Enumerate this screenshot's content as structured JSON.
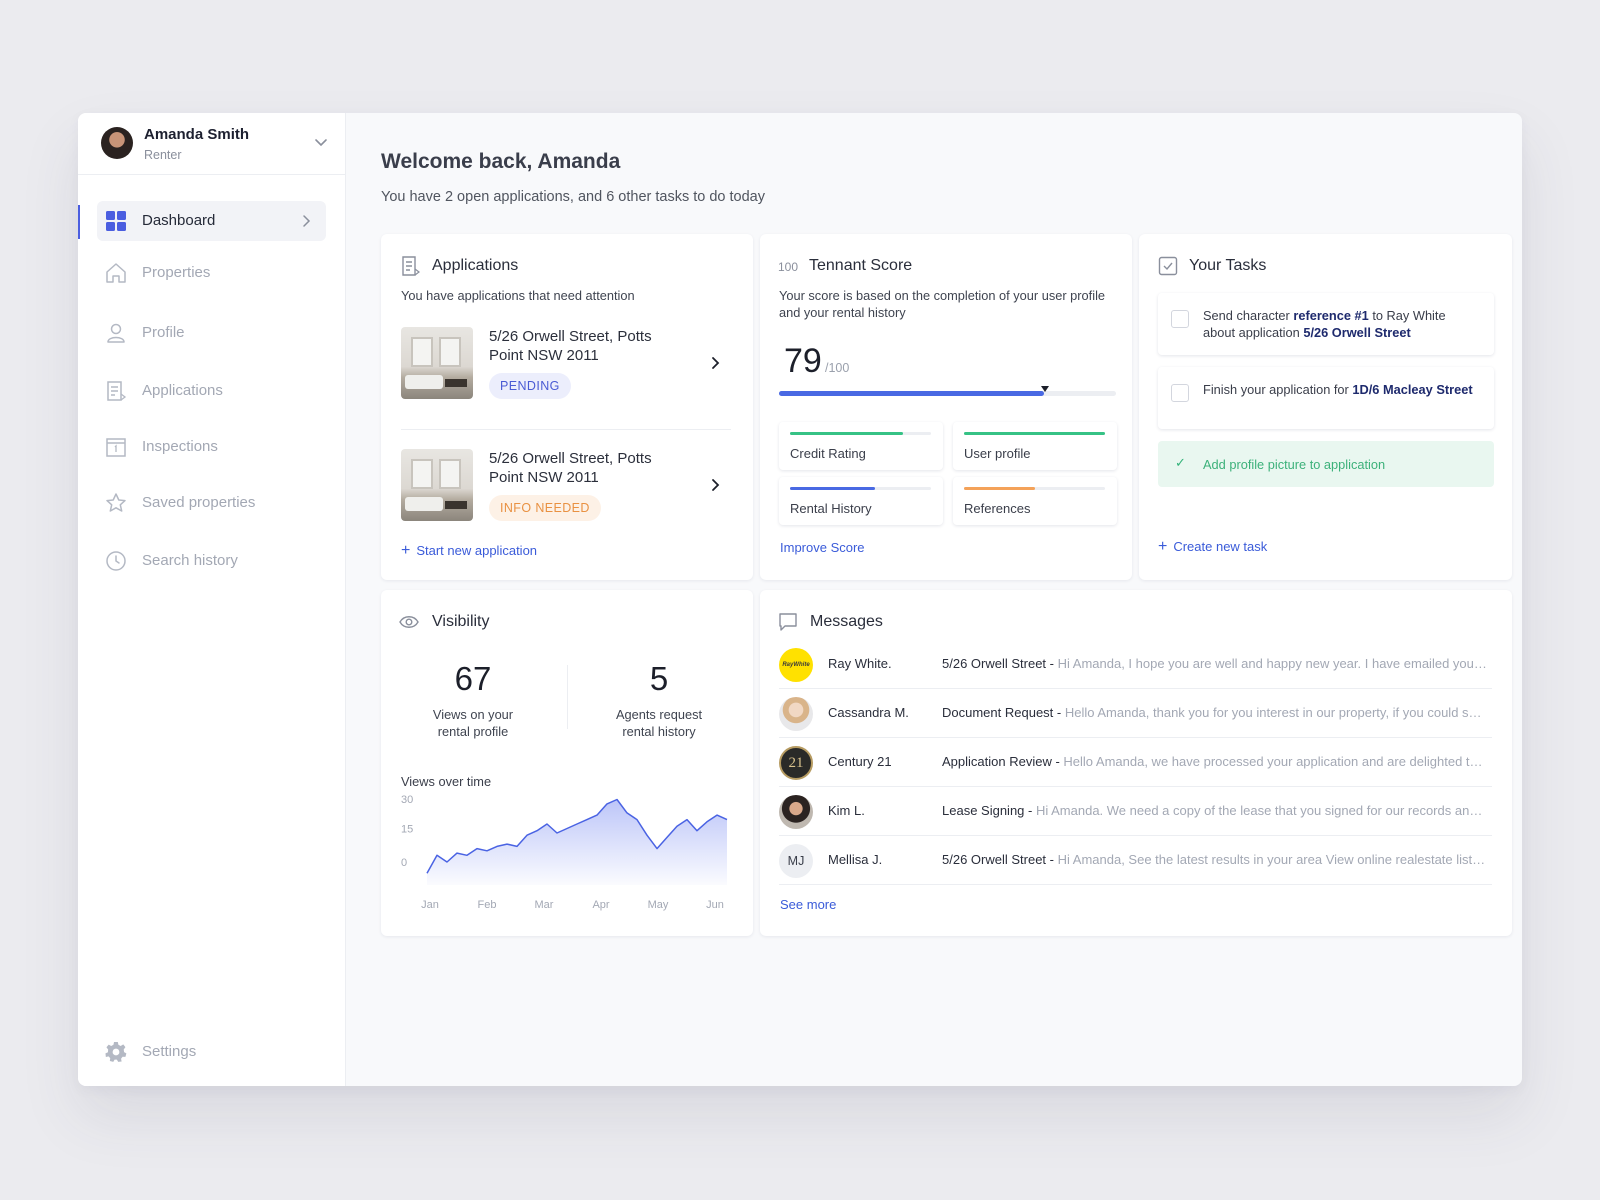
{
  "user": {
    "name": "Amanda Smith",
    "role": "Renter"
  },
  "nav": {
    "items": [
      {
        "label": "Dashboard",
        "icon": "grid-icon",
        "active": true
      },
      {
        "label": "Properties",
        "icon": "home-icon"
      },
      {
        "label": "Profile",
        "icon": "user-icon"
      },
      {
        "label": "Applications",
        "icon": "document-icon"
      },
      {
        "label": "Inspections",
        "icon": "calendar-icon"
      },
      {
        "label": "Saved properties",
        "icon": "star-icon"
      },
      {
        "label": "Search history",
        "icon": "clock-icon"
      }
    ],
    "settings_label": "Settings"
  },
  "header": {
    "welcome": "Welcome back, Amanda",
    "subtitle": "You have 2 open applications, and 6 other tasks to do today"
  },
  "applications": {
    "title": "Applications",
    "description": "You have applications that need attention",
    "items": [
      {
        "address": "5/26 Orwell Street, Potts Point NSW 2011",
        "status": "PENDING"
      },
      {
        "address": "5/26 Orwell Street, Potts Point NSW 2011",
        "status": "INFO NEEDED"
      }
    ],
    "new_link": "Start new application"
  },
  "score": {
    "icon_text": "100",
    "title": "Tennant Score",
    "description": "Your score is based on the completion of your user profile and your rental history",
    "value": "79",
    "max": "/100",
    "progress": 0.79,
    "factors": [
      {
        "label": "Credit Rating",
        "progress": 0.8,
        "color": "#36c285"
      },
      {
        "label": "User profile",
        "progress": 1.0,
        "color": "#36c285"
      },
      {
        "label": "Rental History",
        "progress": 0.6,
        "color": "#4969e3"
      },
      {
        "label": "References",
        "progress": 0.5,
        "color": "#f4a259"
      }
    ],
    "improve_link": "Improve Score"
  },
  "tasks": {
    "title": "Your Tasks",
    "items": [
      {
        "parts": [
          "Send character ",
          "reference #1",
          " to Ray White about application ",
          "5/26 Orwell Street"
        ]
      },
      {
        "parts": [
          "Finish your application for ",
          "1D/6 Macleay Street"
        ]
      }
    ],
    "done_item": "Add profile picture to application",
    "new_link": "Create new task"
  },
  "visibility": {
    "title": "Visibility",
    "views_value": "67",
    "views_label": "Views on your rental profile",
    "requests_value": "5",
    "requests_label": "Agents request rental history",
    "chart_title": "Views over time"
  },
  "chart_data": {
    "type": "area",
    "title": "Views over time",
    "categories": [
      "Jan",
      "Feb",
      "Mar",
      "Apr",
      "May",
      "Jun"
    ],
    "yticks": [
      0,
      15,
      30
    ],
    "ylim": [
      0,
      30
    ],
    "series": [
      {
        "values": [
          -5,
          3,
          0,
          4,
          3,
          6,
          5,
          7,
          8,
          7,
          12,
          14,
          17,
          13,
          15,
          17,
          19,
          21,
          26,
          28,
          22,
          19,
          12,
          6,
          11,
          16,
          19,
          14,
          18,
          21,
          19
        ]
      }
    ]
  },
  "messages": {
    "title": "Messages",
    "items": [
      {
        "sender": "Ray White.",
        "subject": "5/26 Orwell Street - ",
        "preview": "Hi Amanda, I hope you are well and happy new year. I have emailed you the details of the property and the next steps"
      },
      {
        "sender": "Cassandra M.",
        "subject": "Document Request - ",
        "preview": "Hello Amanda, thank you for you interest in our property, if you could send us the documents"
      },
      {
        "sender": "Century 21",
        "subject": "Application Review - ",
        "preview": "Hello Amanda, we have processed your application and are delighted to inform you"
      },
      {
        "sender": "Kim L.",
        "subject": "Lease Signing - ",
        "preview": "Hi Amanda. We need a copy of the lease that you signed for our records and to finalise"
      },
      {
        "sender": "Mellisa J.",
        "subject": "5/26 Orwell Street - ",
        "preview": "Hi Amanda, See the latest results in your area View online realestate listings near you"
      }
    ],
    "initials": "MJ",
    "ray_white_logo": "RayWhite",
    "century_logo": "21",
    "see_more": "See more"
  }
}
